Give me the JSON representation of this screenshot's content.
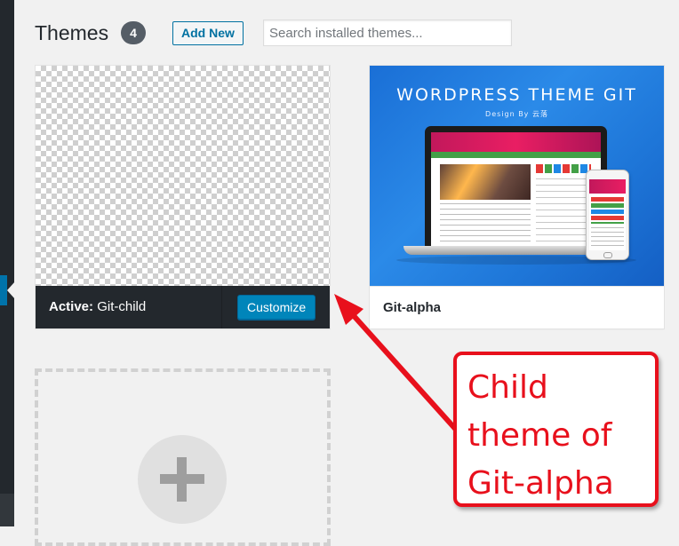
{
  "header": {
    "title": "Themes",
    "count": "4",
    "add_new_label": "Add New"
  },
  "search": {
    "placeholder": "Search installed themes..."
  },
  "themes": [
    {
      "status_prefix": "Active:",
      "name": "Git-child",
      "action_label": "Customize",
      "screenshot": "transparent-checkerboard"
    },
    {
      "name": "Git-alpha",
      "screenshot_title": "WORDPRESS THEME GIT",
      "screenshot_subtitle": "Design By 云落"
    }
  ],
  "add_theme_card": {
    "icon": "plus-icon"
  },
  "annotation": {
    "text": "Child\ntheme of\nGit-alpha",
    "color": "#e8101c"
  },
  "colors": {
    "admin_sidebar": "#23282d",
    "primary_button": "#0085ba",
    "active_bar": "#23282d",
    "page_background": "#f1f1f1"
  }
}
